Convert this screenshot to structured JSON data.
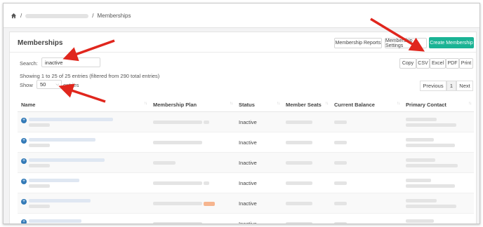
{
  "breadcrumb": {
    "current": "Memberships",
    "separator_1": "/",
    "separator_2": "/"
  },
  "panel": {
    "title": "Memberships",
    "buttons": {
      "reports": "Membership Reports",
      "settings": "Membership Settings",
      "create": "Create Membership"
    },
    "search": {
      "label": "Search:",
      "value": "inactive"
    },
    "export": {
      "copy": "Copy",
      "csv": "CSV",
      "excel": "Excel",
      "pdf": "PDF",
      "print": "Print"
    },
    "info": "Showing 1 to 25 of 25 entries (filtered from 290 total entries)",
    "length": {
      "show": "Show",
      "value": "50",
      "entries": "entries"
    },
    "pagination": {
      "previous": "Previous",
      "page": "1",
      "next": "Next"
    }
  },
  "table": {
    "headers": [
      "Name",
      "Membership Plan",
      "Status",
      "Member Seats",
      "Current Balance",
      "Primary Contact"
    ],
    "rows": [
      {
        "status": "Inactive"
      },
      {
        "status": "Inactive"
      },
      {
        "status": "Inactive"
      },
      {
        "status": "Inactive"
      },
      {
        "status": "Inactive"
      },
      {
        "status": "Inactive"
      }
    ]
  },
  "colors": {
    "accent": "#1ab394",
    "annotation_arrow": "#e0261d",
    "expand_icon": "#337ab7"
  }
}
